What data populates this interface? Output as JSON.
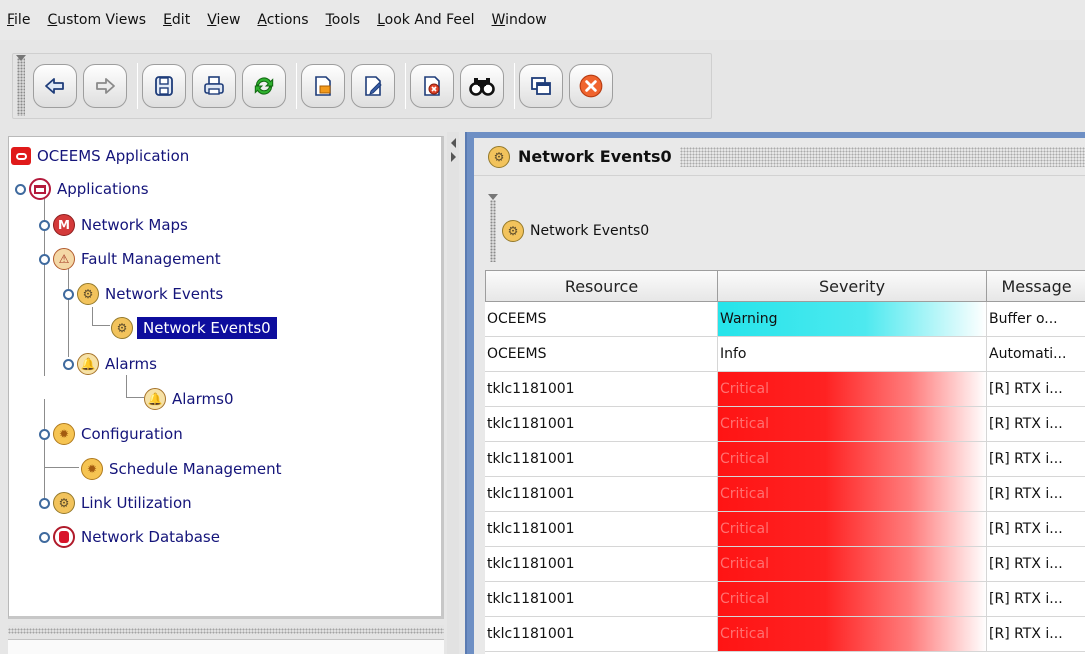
{
  "menubar": {
    "items": [
      {
        "mn": "F",
        "rest": "ile"
      },
      {
        "mn": "C",
        "rest": "ustom Views"
      },
      {
        "mn": "E",
        "rest": "dit"
      },
      {
        "mn": "V",
        "rest": "iew"
      },
      {
        "mn": "A",
        "rest": "ctions"
      },
      {
        "mn": "T",
        "rest": "ools"
      },
      {
        "mn": "L",
        "rest": "ook And Feel"
      },
      {
        "mn": "W",
        "rest": "indow"
      }
    ]
  },
  "toolbar": {
    "buttons": [
      "back-icon",
      "forward-icon",
      "save-icon",
      "print-icon",
      "refresh-icon",
      "export-icon",
      "edit-icon",
      "delete-icon",
      "find-icon",
      "window-icon",
      "exit-icon"
    ]
  },
  "tree": {
    "root": "OCEEMS Application",
    "applications": "Applications",
    "network_maps": "Network Maps",
    "fault_management": "Fault Management",
    "network_events": "Network Events",
    "network_events0": "Network Events0",
    "alarms": "Alarms",
    "alarms0": "Alarms0",
    "configuration": "Configuration",
    "schedule_management": "Schedule Management",
    "link_utilization": "Link Utilization",
    "network_database": "Network Database"
  },
  "content": {
    "title": "Network Events0",
    "sub_tab": "Network Events0"
  },
  "table": {
    "headers": [
      "Resource",
      "Severity",
      "Message"
    ],
    "rows": [
      {
        "resource": "OCEEMS",
        "severity": "Warning",
        "message": "Buffer o..."
      },
      {
        "resource": "OCEEMS",
        "severity": "Info",
        "message": "Automati..."
      },
      {
        "resource": "tklc1181001",
        "severity": "Critical",
        "message": "[R] RTX i..."
      },
      {
        "resource": "tklc1181001",
        "severity": "Critical",
        "message": "[R] RTX i..."
      },
      {
        "resource": "tklc1181001",
        "severity": "Critical",
        "message": "[R] RTX i..."
      },
      {
        "resource": "tklc1181001",
        "severity": "Critical",
        "message": "[R] RTX i..."
      },
      {
        "resource": "tklc1181001",
        "severity": "Critical",
        "message": "[R] RTX i..."
      },
      {
        "resource": "tklc1181001",
        "severity": "Critical",
        "message": "[R] RTX i..."
      },
      {
        "resource": "tklc1181001",
        "severity": "Critical",
        "message": "[R] RTX i..."
      },
      {
        "resource": "tklc1181001",
        "severity": "Critical",
        "message": "[R] RTX i..."
      }
    ]
  },
  "colors": {
    "selection": "#0d0d9d",
    "warning": "#25e4ea",
    "critical": "#ff1414",
    "frame_blue": "#6e8fc4"
  }
}
